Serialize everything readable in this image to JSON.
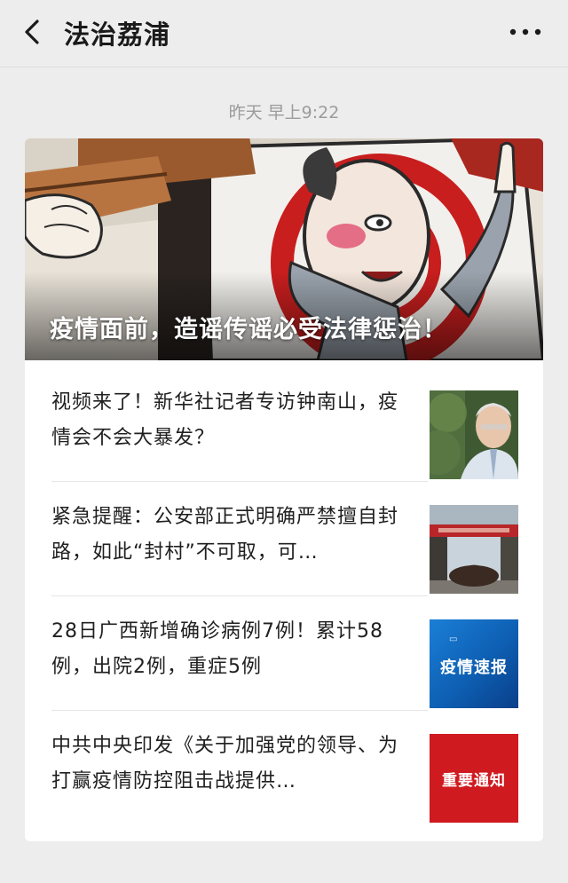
{
  "header": {
    "title": "法治荔浦",
    "back_icon": "chevron-left-icon",
    "more_icon": "more-dots-icon"
  },
  "timestamp": "昨天 早上9:22",
  "hero": {
    "caption": "疫情面前，造谣传谣必受法律惩治！"
  },
  "articles": [
    {
      "title": "视频来了！新华社记者专访钟南山，疫情会不会大暴发？"
    },
    {
      "title": "紧急提醒：公安部正式明确严禁擅自封路，如此“封村”不可取，可…"
    },
    {
      "title": "28日广西新增确诊病例7例！累计58例，出院2例，重症5例",
      "thumb_label": "疫情速报"
    },
    {
      "title": "中共中央印发《关于加强党的领导、为打赢疫情防控阻击战提供…",
      "thumb_label": "重要通知"
    }
  ],
  "colors": {
    "background": "#ededed",
    "card": "#ffffff",
    "thumb_blue": "#1a7fd6",
    "thumb_red": "#cf1a20"
  }
}
